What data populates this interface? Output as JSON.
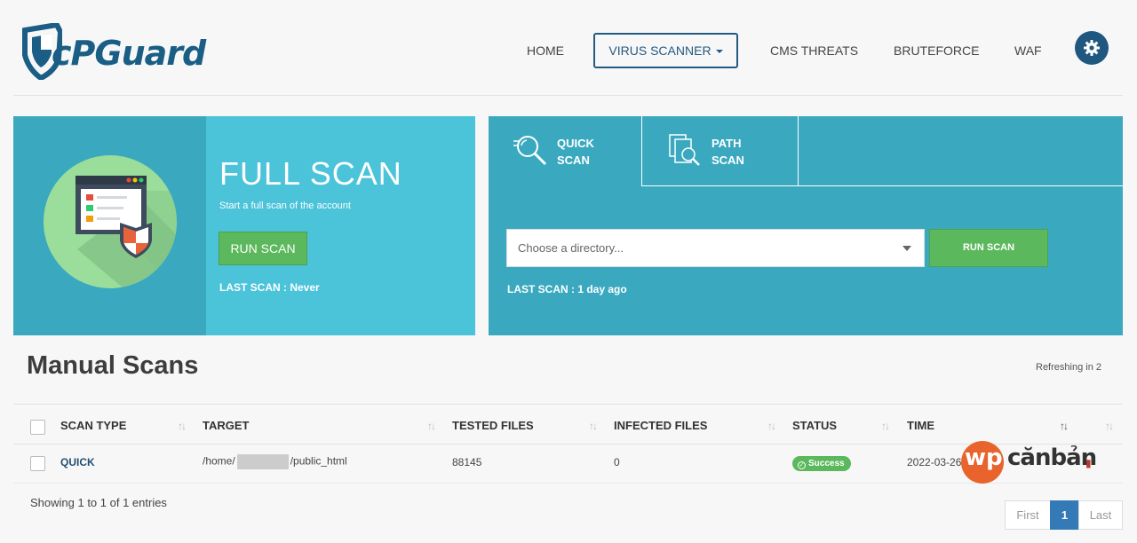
{
  "brand": {
    "logo_text": "cPGuard",
    "accent": "#1f577e"
  },
  "nav": {
    "items": [
      {
        "label": "HOME"
      },
      {
        "label": "VIRUS SCANNER",
        "active": true
      },
      {
        "label": "CMS THREATS"
      },
      {
        "label": "BRUTEFORCE"
      },
      {
        "label": "WAF"
      }
    ],
    "settings_icon": "gear-icon"
  },
  "full_scan": {
    "title": "FULL SCAN",
    "subtitle": "Start a full scan of the account",
    "button": "RUN SCAN",
    "last_scan": "LAST SCAN : Never"
  },
  "quick_scan": {
    "tabs": [
      {
        "label_line1": "QUICK",
        "label_line2": "SCAN",
        "icon": "search-icon",
        "active": true
      },
      {
        "label_line1": "PATH",
        "label_line2": "SCAN",
        "icon": "documents-search-icon"
      }
    ],
    "directory_placeholder": "Choose a directory...",
    "button": "RUN SCAN",
    "last_scan": "LAST SCAN : 1 day ago"
  },
  "manual_scans": {
    "title": "Manual Scans",
    "refresh_text": "Refreshing in 2",
    "columns": [
      "SCAN TYPE",
      "TARGET",
      "TESTED FILES",
      "INFECTED FILES",
      "STATUS",
      "TIME"
    ],
    "rows": [
      {
        "scan_type": "QUICK",
        "target_prefix": "/home/",
        "target_suffix": "/public_html",
        "tested_files": "88145",
        "infected_files": "0",
        "status": "Success",
        "time": "2022-03-26"
      }
    ],
    "showing": "Showing 1 to 1 of 1 entries",
    "pagination": {
      "first": "First",
      "current": "1",
      "last": "Last"
    }
  },
  "watermark": {
    "circle_text": "wp",
    "rest_text": "cănbản"
  }
}
